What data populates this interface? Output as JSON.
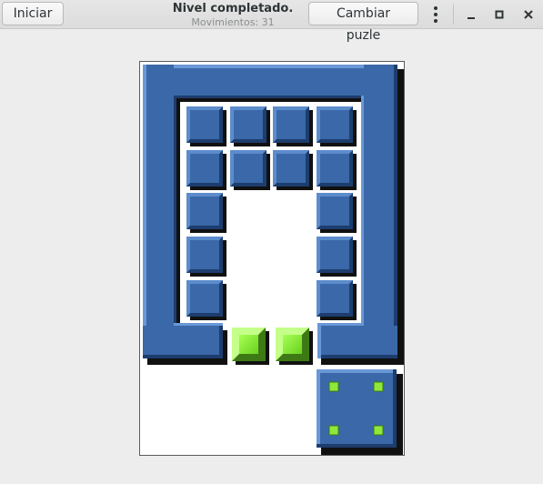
{
  "header": {
    "start_button": "Iniciar",
    "title": "Nivel completado.",
    "subtitle": "Movimientos: 31",
    "change_button": "Cambiar puzle",
    "menu_icon": "vertical-dots-icon",
    "minimize_icon": "minimize-icon",
    "maximize_icon": "maximize-icon",
    "close_icon": "close-icon"
  },
  "puzzle": {
    "solved": true,
    "moves": 31,
    "colors": {
      "frame": "#3a68a8",
      "frame_dark": "#1d3d6e",
      "frame_light": "#5c8ccc",
      "goal_green": "#8ee83a",
      "goal_dark": "#3d7a16",
      "shadow": "#111111"
    },
    "pieces_description": "blue frame, blue small blocks, two green goal blocks, large 2x2 target block"
  }
}
